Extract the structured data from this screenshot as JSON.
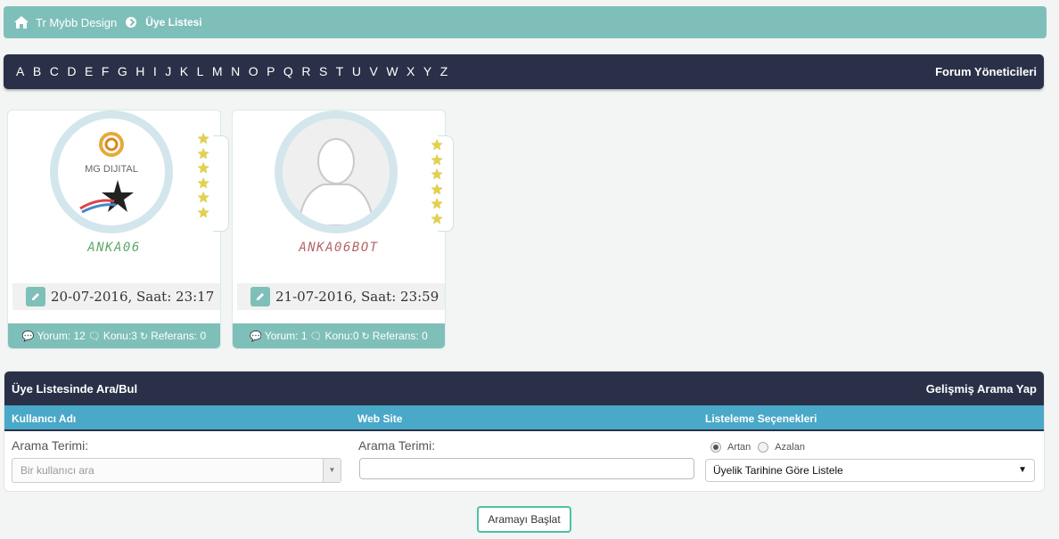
{
  "breadcrumb": {
    "home": "Tr Mybb Design",
    "current": "Üye Listesi"
  },
  "alphabet": [
    "A",
    "B",
    "C",
    "D",
    "E",
    "F",
    "G",
    "H",
    "I",
    "J",
    "K",
    "L",
    "M",
    "N",
    "O",
    "P",
    "Q",
    "R",
    "S",
    "T",
    "U",
    "V",
    "W",
    "X",
    "Y",
    "Z"
  ],
  "admins_link": "Forum Yöneticileri",
  "members": [
    {
      "username": "ANKA06",
      "username_color": "#5fa86a",
      "date": "20-07-2016, Saat: 23:17",
      "stats": {
        "posts": "Yorum: 12",
        "threads": "Konu:3",
        "referrals": "Referans: 0"
      },
      "avatar_logo_text": "MG DIJITAL",
      "stars": 6
    },
    {
      "username": "ANKA06BOT",
      "username_color": "#b56466",
      "date": "21-07-2016, Saat: 23:59",
      "stats": {
        "posts": "Yorum: 1",
        "threads": "Konu:0",
        "referrals": "Referans: 0"
      },
      "stars": 6
    }
  ],
  "search": {
    "title": "Üye Listesinde Ara/Bul",
    "advanced": "Gelişmiş Arama Yap",
    "columns": {
      "username": "Kullanıcı Adı",
      "website": "Web Site",
      "options": "Listeleme Seçenekleri"
    },
    "term_label_user": "Arama Terimi:",
    "term_label_site": "Arama Terimi:",
    "user_placeholder": "Bir kullanıcı ara",
    "radio_asc": "Artan",
    "radio_desc": "Azalan",
    "order_selected": "Üyelik Tarihine Göre Listele",
    "submit": "Aramayı Başlat"
  },
  "colors": {
    "teal": "#7fbfb9",
    "navy": "#293048",
    "blue": "#4aa8c8",
    "button_border": "#4fc0a3"
  }
}
